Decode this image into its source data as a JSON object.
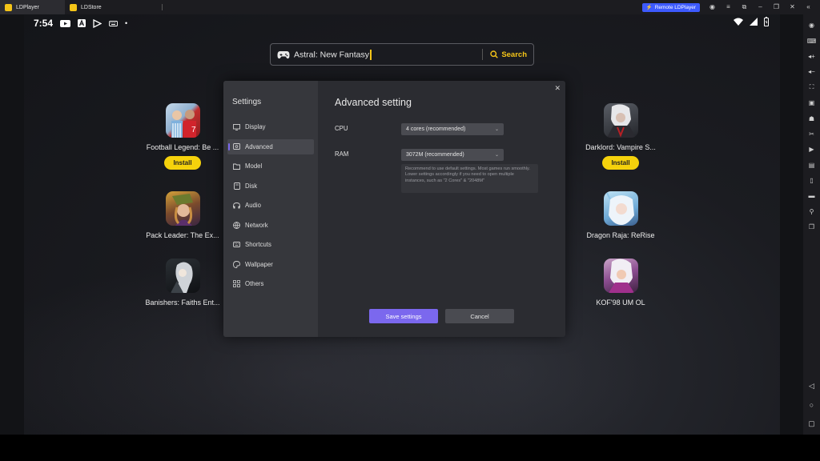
{
  "window": {
    "tabs": [
      {
        "label": "LDPlayer",
        "active": true
      },
      {
        "label": "LDStore",
        "active": false
      }
    ],
    "remote_label": "Remote LDPlayer",
    "accent": "#3d5afe"
  },
  "statusbar": {
    "time": "7:54",
    "icons": [
      "youtube-icon",
      "a-icon",
      "play-store-icon",
      "keyboard-icon",
      "dot-icon"
    ],
    "right_icons": [
      "wifi-icon",
      "signal-icon",
      "battery-icon"
    ]
  },
  "search": {
    "query": "Astral: New Fantasy",
    "button_label": "Search",
    "accent": "#f5c518"
  },
  "apps": [
    {
      "name": "Football Legend: Be ...",
      "install_label": "Install"
    },
    {
      "name": "Pack Leader: The Ex...",
      "install_label": ""
    },
    {
      "name": "Banishers: Faiths Ent...",
      "install_label": ""
    },
    {
      "name": "Darklord: Vampire S...",
      "install_label": "Install"
    },
    {
      "name": "Dragon Raja: ReRise",
      "install_label": ""
    },
    {
      "name": "KOF'98 UM OL",
      "install_label": ""
    }
  ],
  "settings": {
    "title": "Settings",
    "menu": [
      {
        "label": "Display",
        "icon": "monitor-icon"
      },
      {
        "label": "Advanced",
        "icon": "advanced-icon",
        "active": true
      },
      {
        "label": "Model",
        "icon": "folder-icon"
      },
      {
        "label": "Disk",
        "icon": "disk-icon"
      },
      {
        "label": "Audio",
        "icon": "audio-icon"
      },
      {
        "label": "Network",
        "icon": "globe-icon"
      },
      {
        "label": "Shortcuts",
        "icon": "keyboard-icon"
      },
      {
        "label": "Wallpaper",
        "icon": "palette-icon"
      },
      {
        "label": "Others",
        "icon": "grid-icon"
      }
    ],
    "heading": "Advanced setting",
    "cpu_label": "CPU",
    "cpu_value": "4 cores (recommended)",
    "ram_label": "RAM",
    "ram_value": "3072M (recommended)",
    "hint_line1": "Recommend to use default settings. Most games run smoothly.",
    "hint_line2": "Lower settings accordingly if you need to open multiple instances, such as \"2 Cores\" & \"2048M\"",
    "save_label": "Save settings",
    "cancel_label": "Cancel",
    "accent": "#7b68ee"
  },
  "toolbar": {
    "icons": [
      "gamepad-icon",
      "keyboard-mapping-icon",
      "volume-up-icon",
      "volume-down-icon",
      "screenshot-icon",
      "apk-icon",
      "robot-icon",
      "scissors-icon",
      "record-icon",
      "script-icon",
      "shake-icon",
      "folder-icon",
      "location-icon",
      "multi-instance-icon"
    ],
    "nav": [
      "back-icon",
      "home-icon",
      "recents-icon"
    ]
  }
}
